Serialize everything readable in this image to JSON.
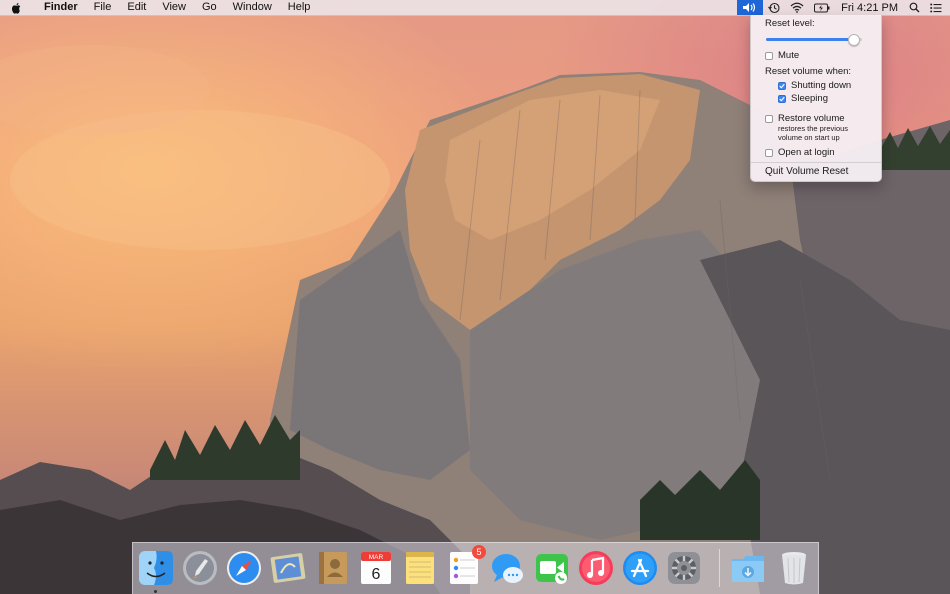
{
  "menubar": {
    "app_name": "Finder",
    "menus": [
      "File",
      "Edit",
      "View",
      "Go",
      "Window",
      "Help"
    ],
    "clock": "Fri 4:21 PM"
  },
  "volume_menu": {
    "reset_level_label": "Reset level:",
    "reset_level_value": 0.95,
    "mute_label": "Mute",
    "mute_checked": false,
    "reset_when_label": "Reset volume when:",
    "shutting_down_label": "Shutting down",
    "shutting_down_checked": true,
    "sleeping_label": "Sleeping",
    "sleeping_checked": true,
    "restore_label": "Restore volume",
    "restore_checked": false,
    "restore_sub1": "restores the previous",
    "restore_sub2": "volume on start up",
    "open_login_label": "Open at login",
    "open_login_checked": false,
    "quit_label": "Quit Volume Reset"
  },
  "dock": {
    "calendar_month": "MAR",
    "calendar_day": "6",
    "reminders_badge": "5"
  },
  "colors": {
    "accent": "#1f66d6",
    "badge": "#f44a3d"
  }
}
